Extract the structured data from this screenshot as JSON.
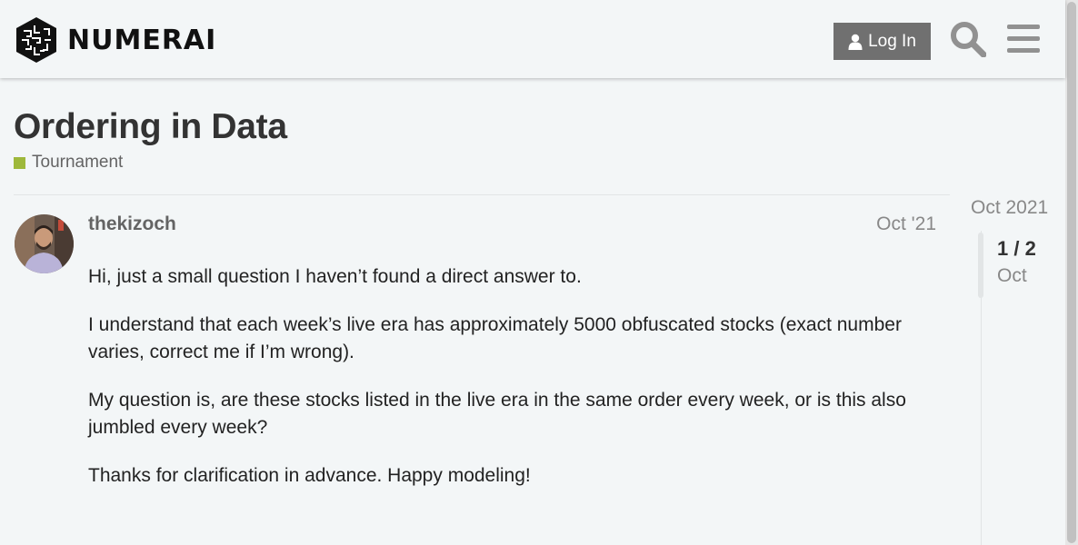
{
  "header": {
    "brand": "NUMERAI",
    "login_label": "Log In"
  },
  "topic": {
    "title": "Ordering in Data",
    "category": "Tournament",
    "category_color": "#9eb83b"
  },
  "post": {
    "username": "thekizoch",
    "date": "Oct '21",
    "paragraphs": [
      "Hi, just a small question I haven’t found a direct answer to.",
      "I understand that each week’s live era has approximately 5000 obfuscated stocks (exact number varies, correct me if I’m wrong).",
      "My question is, are these stocks listed in the live era in the same order every week, or is this also jumbled every week?",
      "Thanks for clarification in advance. Happy modeling!"
    ]
  },
  "timeline": {
    "top_date": "Oct 2021",
    "position": "1 / 2",
    "current_label": "Oct"
  },
  "icons": {
    "search": "search-icon",
    "menu": "hamburger-menu-icon",
    "user": "user-icon"
  }
}
